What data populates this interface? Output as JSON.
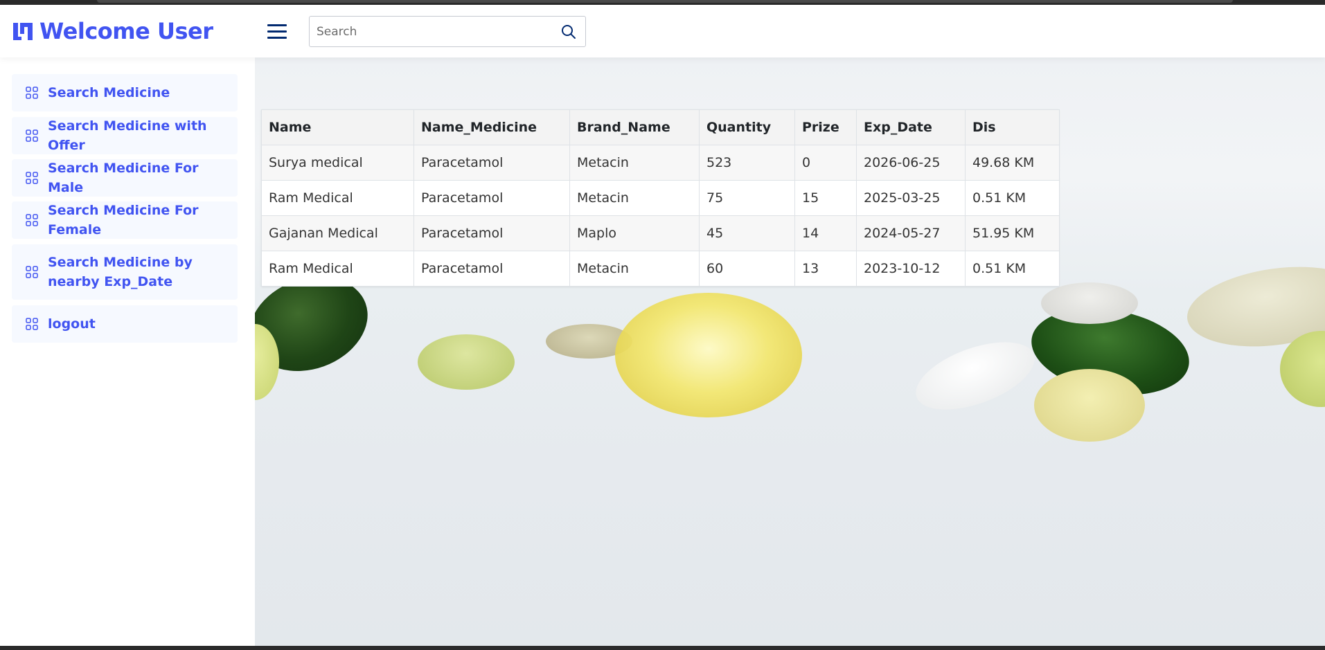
{
  "header": {
    "brand_text": "Welcome User",
    "search_placeholder": "Search"
  },
  "sidebar": {
    "items": [
      {
        "label": "Search Medicine"
      },
      {
        "label": "Search Medicine with Offer"
      },
      {
        "label": "Search Medicine For Male"
      },
      {
        "label": "Search Medicine For Female"
      },
      {
        "label": "Search Medicine by nearby Exp_Date"
      },
      {
        "label": "logout"
      }
    ]
  },
  "table": {
    "headers": [
      "Name",
      "Name_Medicine",
      "Brand_Name",
      "Quantity",
      "Prize",
      "Exp_Date",
      "Dis"
    ],
    "rows": [
      [
        "Surya medical",
        "Paracetamol",
        "Metacin",
        "523",
        "0",
        "2026-06-25",
        "49.68 KM"
      ],
      [
        "Ram Medical",
        "Paracetamol",
        "Metacin",
        "75",
        "15",
        "2025-03-25",
        "0.51 KM"
      ],
      [
        "Gajanan Medical",
        "Paracetamol",
        "Maplo",
        "45",
        "14",
        "2024-05-27",
        "51.95 KM"
      ],
      [
        "Ram Medical",
        "Paracetamol",
        "Metacin",
        "60",
        "13",
        "2023-10-12",
        "0.51 KM"
      ]
    ]
  },
  "colors": {
    "accent": "#4154f1",
    "dark": "#012970",
    "nav_bg": "#f6f9ff"
  },
  "icons": {
    "brand": "logo-icon",
    "menu": "hamburger-icon",
    "search": "search-icon",
    "nav": "grid-icon"
  }
}
